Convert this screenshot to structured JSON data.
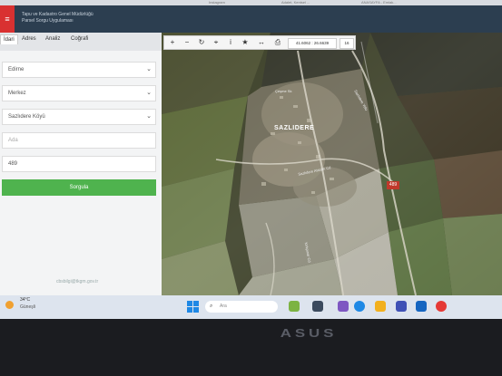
{
  "browser_tabs": [
    "Instagram",
    "Adalet, Kentsel ...",
    "ANASAYFA - Emlak..."
  ],
  "app": {
    "title_line1": "Tapu ve Kadastro Genel Müdürlüğü",
    "title_line2": "Parsel Sorgu Uygulaması",
    "menu_icon": "hamburger-icon"
  },
  "sidebar": {
    "tabs": [
      "İdari",
      "Adres",
      "Analiz",
      "Coğrafi"
    ],
    "active_tab": "İdari",
    "fields": {
      "province": "Edirne",
      "district": "Merkez",
      "neighborhood": "Sazlıdere Köyü",
      "block_placeholder": "Ada",
      "parcel_value": "489"
    },
    "query_button": "Sorgula",
    "footer_mail": "cbsbilgi@tkgm.gov.tr"
  },
  "toolbar": {
    "tools": [
      {
        "icon": "zoom-in-icon",
        "glyph": "+"
      },
      {
        "icon": "zoom-out-icon",
        "glyph": "−"
      },
      {
        "icon": "refresh-icon",
        "glyph": "↻"
      },
      {
        "icon": "locate-icon",
        "glyph": "⌖"
      },
      {
        "icon": "info-icon",
        "glyph": "i"
      },
      {
        "icon": "star-icon",
        "glyph": "★"
      },
      {
        "icon": "measure-icon",
        "glyph": "↔"
      },
      {
        "icon": "print-icon",
        "glyph": "⎙"
      }
    ],
    "coordinates": "41.6062 : 26.6639",
    "zoom_level": "16"
  },
  "map": {
    "village_label": "SAZLIDERE",
    "road_labels": [
      "Çeşme Sk",
      "Sazlıdere Atatürk Cd",
      "Kırkpınar Cd",
      "Sazlıdere Yolu"
    ],
    "parcel_badge": "489"
  },
  "taskbar": {
    "temperature": "34°C",
    "weather": "Güneşli",
    "search_placeholder": "Ara"
  },
  "bezel": {
    "brand": "ASUS"
  }
}
